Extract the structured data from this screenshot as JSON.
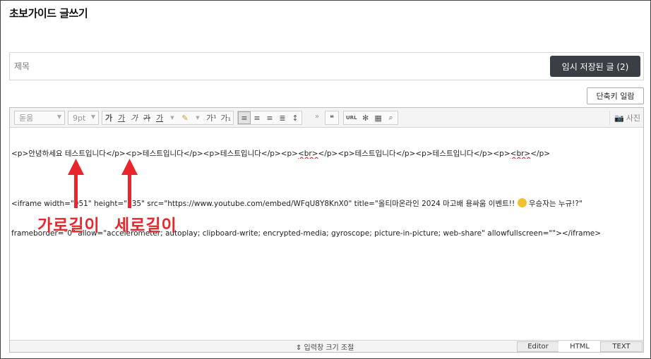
{
  "page": {
    "title": "초보가이드 글쓰기"
  },
  "title_field": {
    "placeholder": "제목",
    "value": ""
  },
  "draft_button": {
    "label": "임시 저장된 글 (2)"
  },
  "shortcut_button": {
    "label": "단축키 일람"
  },
  "toolbar": {
    "font_family": "돋움",
    "font_size": "9pt",
    "format_buttons": [
      "가",
      "가",
      "가",
      "가",
      "가"
    ],
    "sup_label": "가¹",
    "sub_label": "가₁",
    "quote_label": "❝",
    "url_label": "URL",
    "photo_label": "사진"
  },
  "code": {
    "line1_parts": [
      "<p>안녕하세요 테스트입니다</p><p>테스트입니다</p><p>테스트입니다</p><p>",
      "<br>",
      "</p><p>테스트입니다</p><p>테스트입니다</p><p>",
      "<br>",
      "</p>"
    ],
    "line3_a": "<iframe width=\"951\" height=\"535\" src=\"https://www.youtube.com/embed/WFqU8Y8KnX0\" title=\"올티마온라인 2024 마고배 용싸움 이벤트!! ",
    "line3_b": " 우승자는 누규!?\"",
    "line4": "frameborder=\"0\" allow=\"accelerometer; autoplay; clipboard-write; encrypted-media; gyroscope; picture-in-picture; web-share\" allowfullscreen=\"\"></iframe>"
  },
  "annotations": {
    "width_label": "가로길이",
    "height_label": "세로길이"
  },
  "bottom": {
    "resize_label": "⇕ 입력창 크기 조절",
    "tabs": [
      "Editor",
      "HTML",
      "TEXT"
    ],
    "active_tab": "HTML"
  },
  "colors": {
    "annotation": "#e8262b",
    "draft_button_bg": "#3a3f45"
  }
}
